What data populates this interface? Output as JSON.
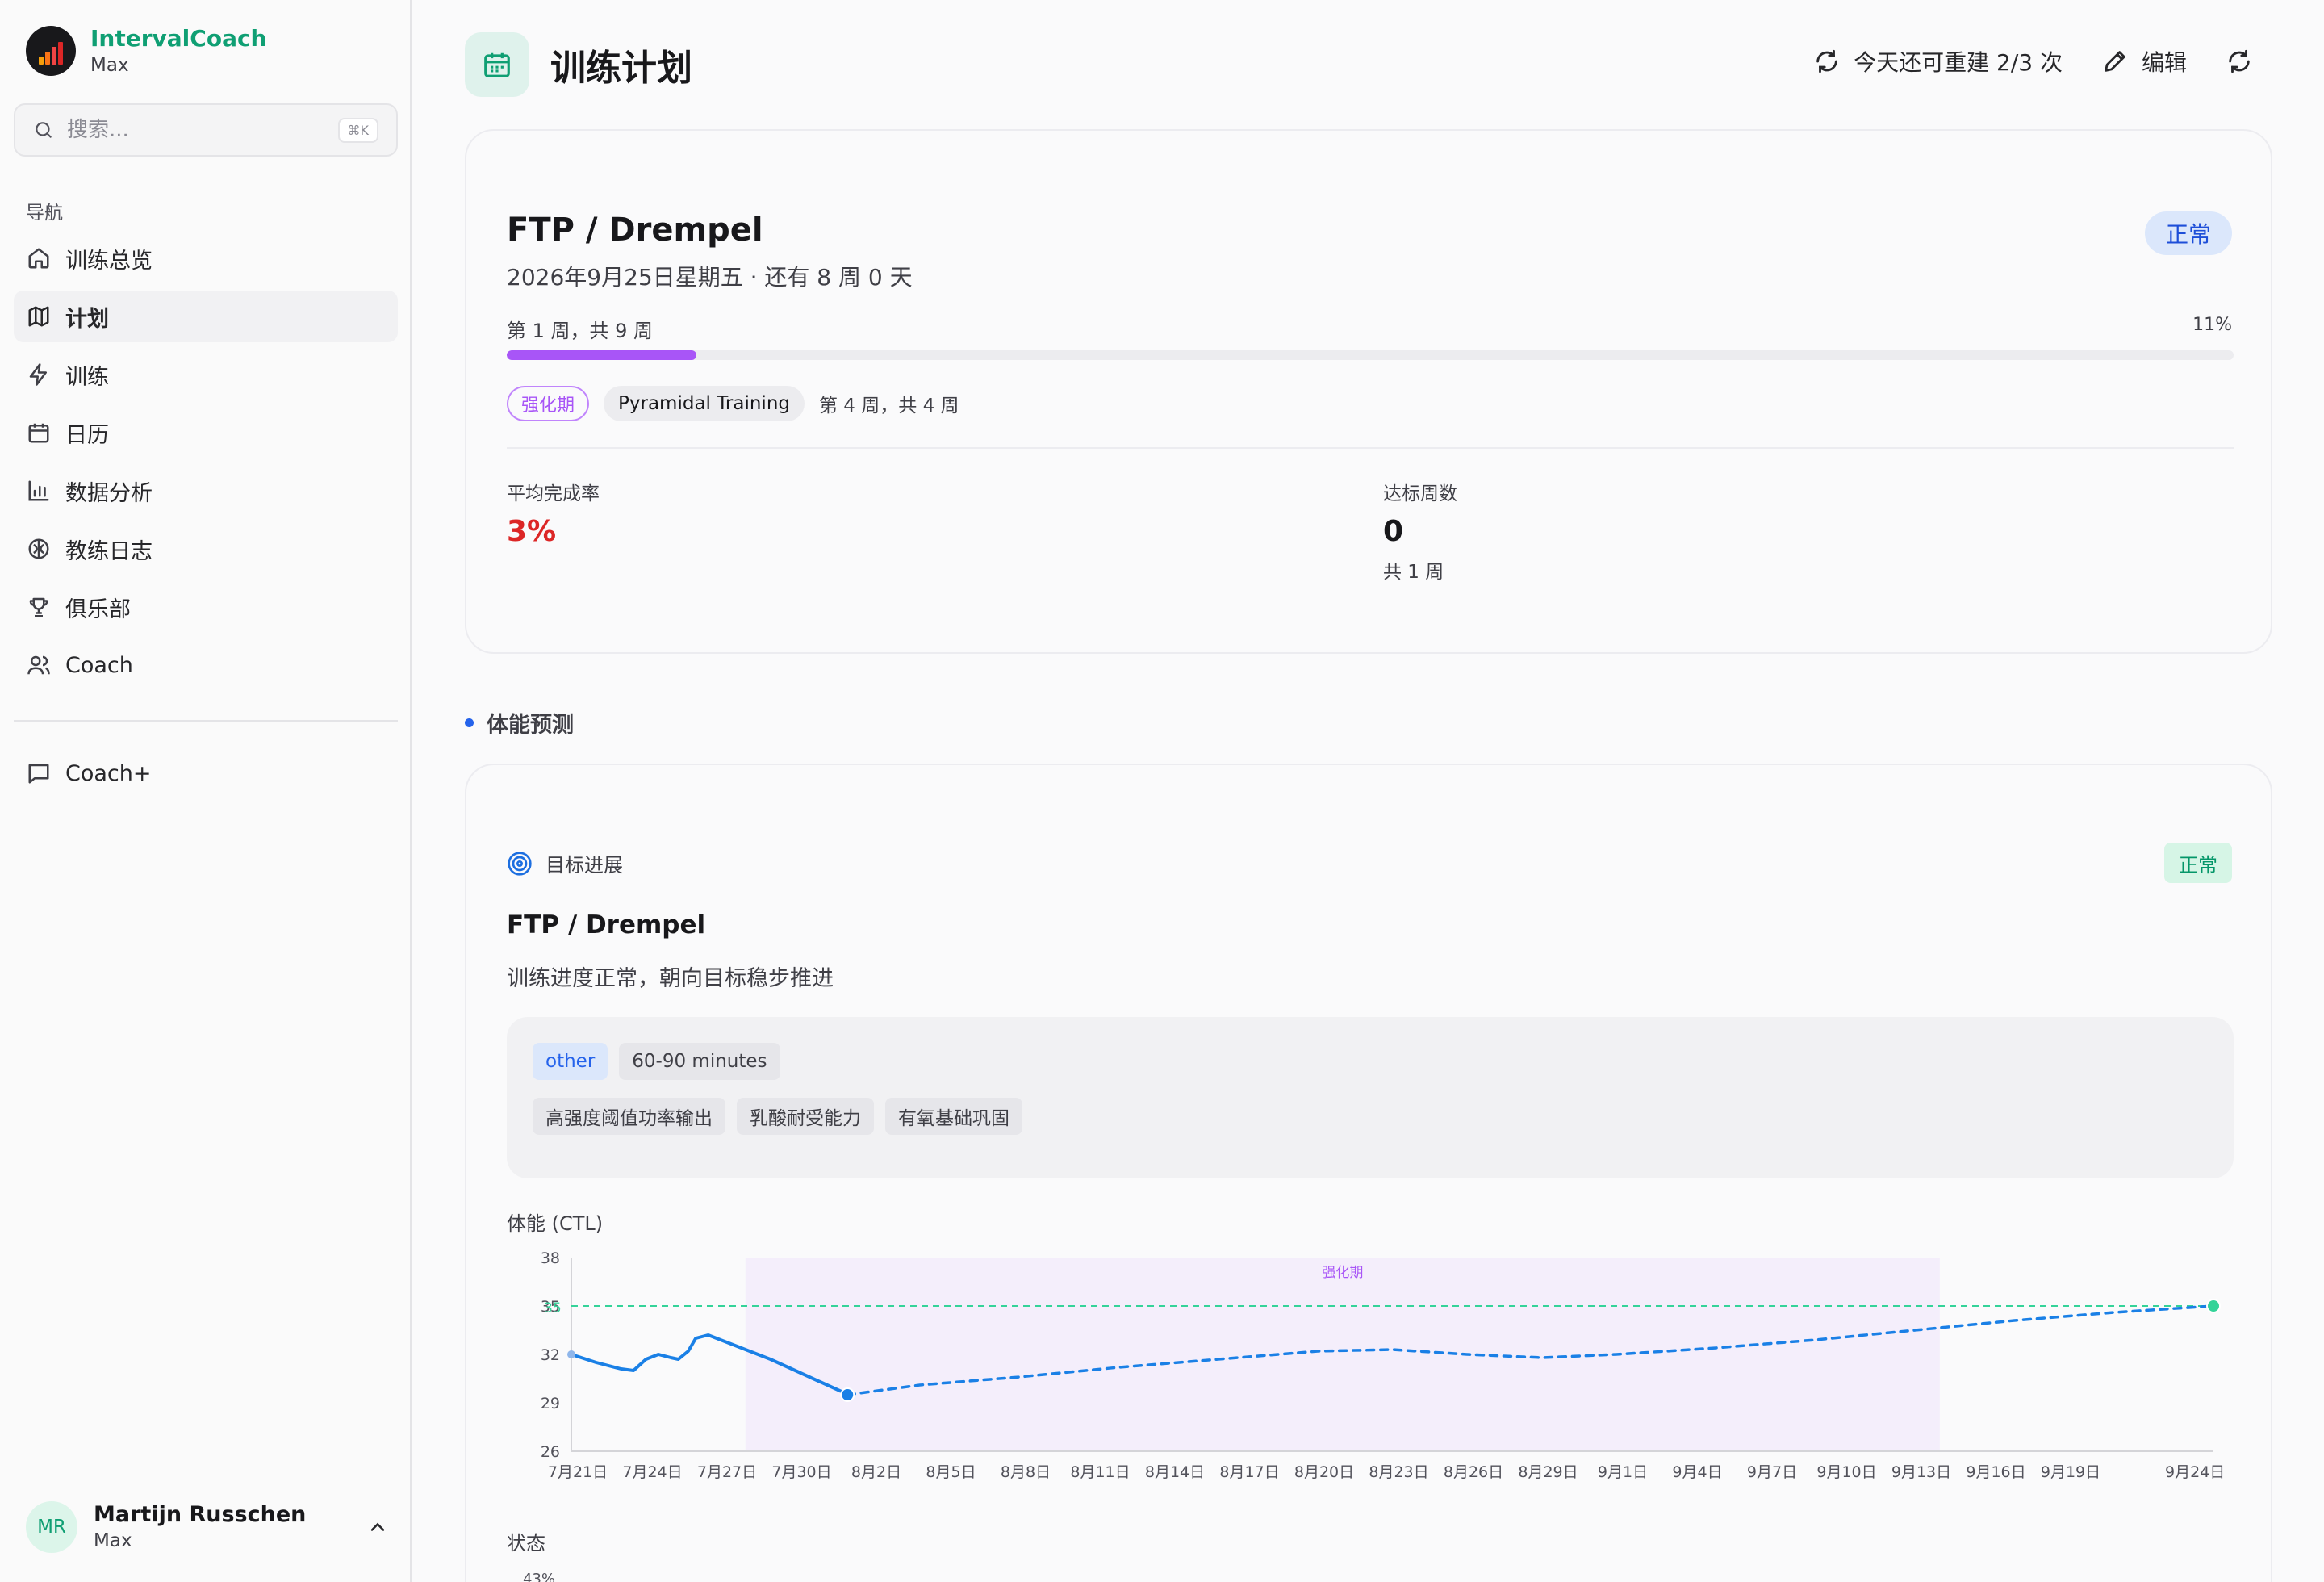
{
  "app": {
    "name": "IntervalCoach",
    "profile": "Max"
  },
  "search": {
    "placeholder": "搜索...",
    "shortcut": "⌘K"
  },
  "nav": {
    "heading": "导航",
    "items": [
      {
        "label": "训练总览",
        "icon": "home-icon"
      },
      {
        "label": "计划",
        "icon": "map-icon",
        "active": true
      },
      {
        "label": "训练",
        "icon": "zap-icon"
      },
      {
        "label": "日历",
        "icon": "calendar-icon"
      },
      {
        "label": "数据分析",
        "icon": "bar-chart-icon"
      },
      {
        "label": "教练日志",
        "icon": "brain-icon"
      },
      {
        "label": "俱乐部",
        "icon": "trophy-icon"
      },
      {
        "label": "Coach",
        "icon": "users-icon"
      }
    ],
    "secondary": [
      {
        "label": "Coach+",
        "icon": "message-square-icon"
      }
    ]
  },
  "user": {
    "initials": "MR",
    "name": "Martijn Russchen",
    "profile": "Max"
  },
  "header": {
    "title": "训练计划",
    "rebuild_label": "今天还可重建 2/3 次",
    "edit_label": "编辑"
  },
  "plan": {
    "goal_title": "FTP / Drempel",
    "goal_date": "2026年9月25日星期五 · 还有 8 周 0 天",
    "status": "正常",
    "week_label": "第 1 周，共 9 周",
    "progress_pct_label": "11%",
    "progress_fraction": 0.11,
    "phase": "强化期",
    "plan_name": "Pyramidal Training",
    "phase_week": "第 4 周，共 4 周",
    "stats": {
      "completion_label": "平均完成率",
      "completion_value": "3%",
      "weeks_label": "达标周数",
      "weeks_value": "0",
      "weeks_sub": "共 1 周"
    }
  },
  "forecast": {
    "section_title": "体能预测",
    "progress_head": "目标进展",
    "badge": "正常",
    "goal_title": "FTP / Drempel",
    "goal_desc": "训练进度正常，朝向目标稳步推进",
    "chips_row1": [
      "other",
      "60-90 minutes"
    ],
    "chips_row2": [
      "高强度阈值功率输出",
      "乳酸耐受能力",
      "有氧基础巩固"
    ],
    "ctl_label": "体能 (CTL)",
    "state_label": "状态",
    "state_first_tick": "43%"
  },
  "colors": {
    "brand": "#0f9f73",
    "accent_purple": "#a855f7",
    "line_blue": "#1a80e6",
    "target_green": "#34d399",
    "danger": "#dc2626"
  },
  "chart_data": {
    "type": "line",
    "ylabel": "体能 (CTL)",
    "ylim": [
      26,
      38
    ],
    "yticks": [
      38,
      35,
      32,
      29,
      26
    ],
    "x_tick_labels": [
      "7月21日",
      "7月24日",
      "7月27日",
      "7月30日",
      "8月2日",
      "8月5日",
      "8月8日",
      "8月11日",
      "8月14日",
      "8月17日",
      "8月20日",
      "8月23日",
      "8月26日",
      "8月29日",
      "9月1日",
      "9月4日",
      "9月7日",
      "9月10日",
      "9月13日",
      "9月16日",
      "9月19日",
      "9月24日"
    ],
    "x_day_offsets": [
      0,
      3,
      6,
      9,
      12,
      15,
      18,
      21,
      24,
      27,
      30,
      33,
      36,
      39,
      42,
      45,
      48,
      51,
      54,
      57,
      60,
      65
    ],
    "phase_band": {
      "label": "强化期",
      "from_day": 7,
      "to_day": 55
    },
    "target": {
      "value": 35,
      "label": "35"
    },
    "series": [
      {
        "style": "solid",
        "points": [
          [
            0,
            32.0
          ],
          [
            1,
            31.5
          ],
          [
            2,
            31.1
          ],
          [
            2.5,
            31.0
          ],
          [
            3,
            31.7
          ],
          [
            3.5,
            32.0
          ],
          [
            4,
            31.8
          ],
          [
            4.3,
            31.7
          ],
          [
            4.7,
            32.2
          ],
          [
            5,
            33.0
          ],
          [
            5.5,
            33.2
          ],
          [
            6,
            32.9
          ],
          [
            7,
            32.3
          ],
          [
            8,
            31.7
          ],
          [
            9,
            31.0
          ],
          [
            10,
            30.3
          ],
          [
            11,
            29.6
          ],
          [
            11.1,
            29.5
          ]
        ]
      },
      {
        "style": "dashed",
        "points": [
          [
            11.1,
            29.5
          ],
          [
            14,
            30.1
          ],
          [
            18,
            30.6
          ],
          [
            22,
            31.2
          ],
          [
            26,
            31.7
          ],
          [
            30,
            32.2
          ],
          [
            33,
            32.3
          ],
          [
            36,
            32.0
          ],
          [
            39,
            31.8
          ],
          [
            42,
            32.0
          ],
          [
            46,
            32.4
          ],
          [
            50,
            32.9
          ],
          [
            54,
            33.5
          ],
          [
            58,
            34.1
          ],
          [
            62,
            34.6
          ],
          [
            66,
            35.0
          ]
        ]
      }
    ]
  }
}
